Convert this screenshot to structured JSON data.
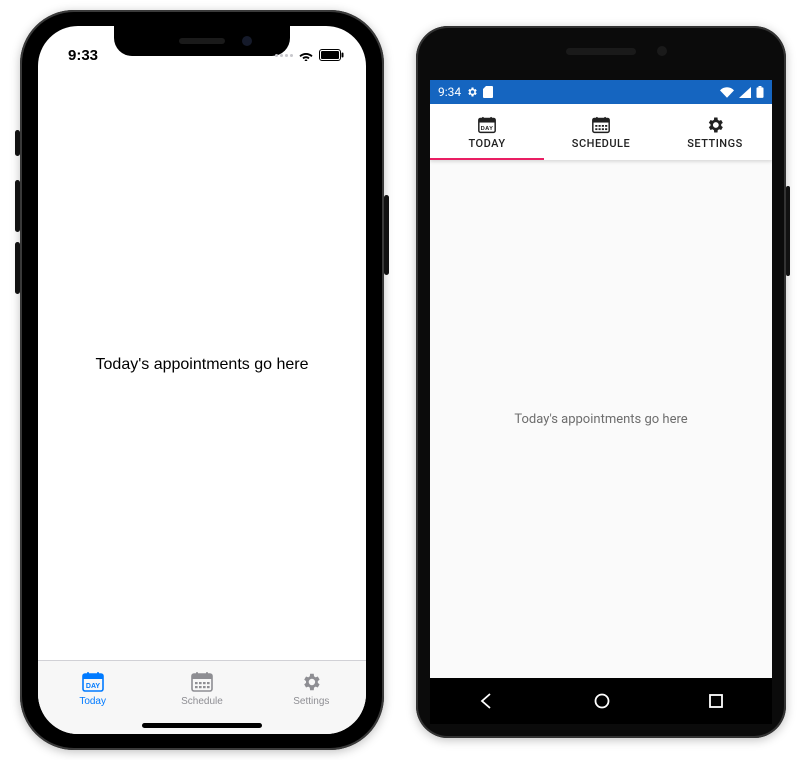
{
  "ios": {
    "status": {
      "time": "9:33"
    },
    "content_text": "Today's appointments go here",
    "tabs": [
      {
        "label": "Today",
        "icon": "calendar-day-icon",
        "active": true
      },
      {
        "label": "Schedule",
        "icon": "calendar-grid-icon",
        "active": false
      },
      {
        "label": "Settings",
        "icon": "gear-icon",
        "active": false
      }
    ]
  },
  "android": {
    "status": {
      "time": "9:34"
    },
    "content_text": "Today's appointments go here",
    "tabs": [
      {
        "label": "TODAY",
        "icon": "calendar-day-icon",
        "active": true
      },
      {
        "label": "SCHEDULE",
        "icon": "calendar-grid-icon",
        "active": false
      },
      {
        "label": "SETTINGS",
        "icon": "gear-icon",
        "active": false
      }
    ]
  }
}
